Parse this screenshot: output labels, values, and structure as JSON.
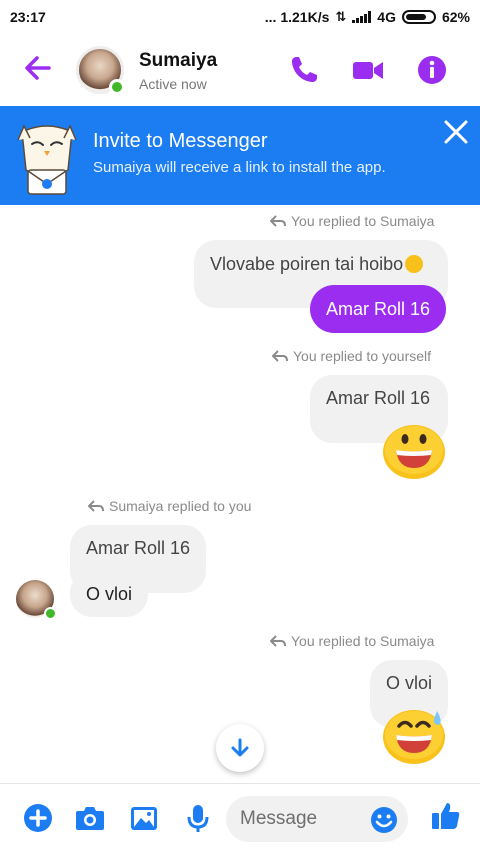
{
  "status_bar": {
    "time": "23:17",
    "network_speed": "... 1.21K/s",
    "network_type": "4G",
    "battery": "62%"
  },
  "header": {
    "contact_name": "Sumaiya",
    "contact_status": "Active now",
    "accent_color": "#9b2df0"
  },
  "invite_banner": {
    "title": "Invite to Messenger",
    "subtitle": "Sumaiya will receive a link to install the app.",
    "background_color": "#1c7df2"
  },
  "messages": [
    {
      "reply_note": "You replied to Sumaiya",
      "quoted": "Vlovabe poiren tai hoibo",
      "text": "Amar Roll 16"
    },
    {
      "reply_note": "You replied to yourself",
      "quoted": "Amar Roll 16",
      "emoji": "grinning-face"
    },
    {
      "reply_note": "Sumaiya replied to you",
      "quoted": "Amar Roll 16",
      "text": "O vloi"
    },
    {
      "reply_note": "You replied to Sumaiya",
      "quoted": "O vloi",
      "emoji": "grinning-face-with-sweat"
    }
  ],
  "composer": {
    "placeholder": "Message"
  }
}
